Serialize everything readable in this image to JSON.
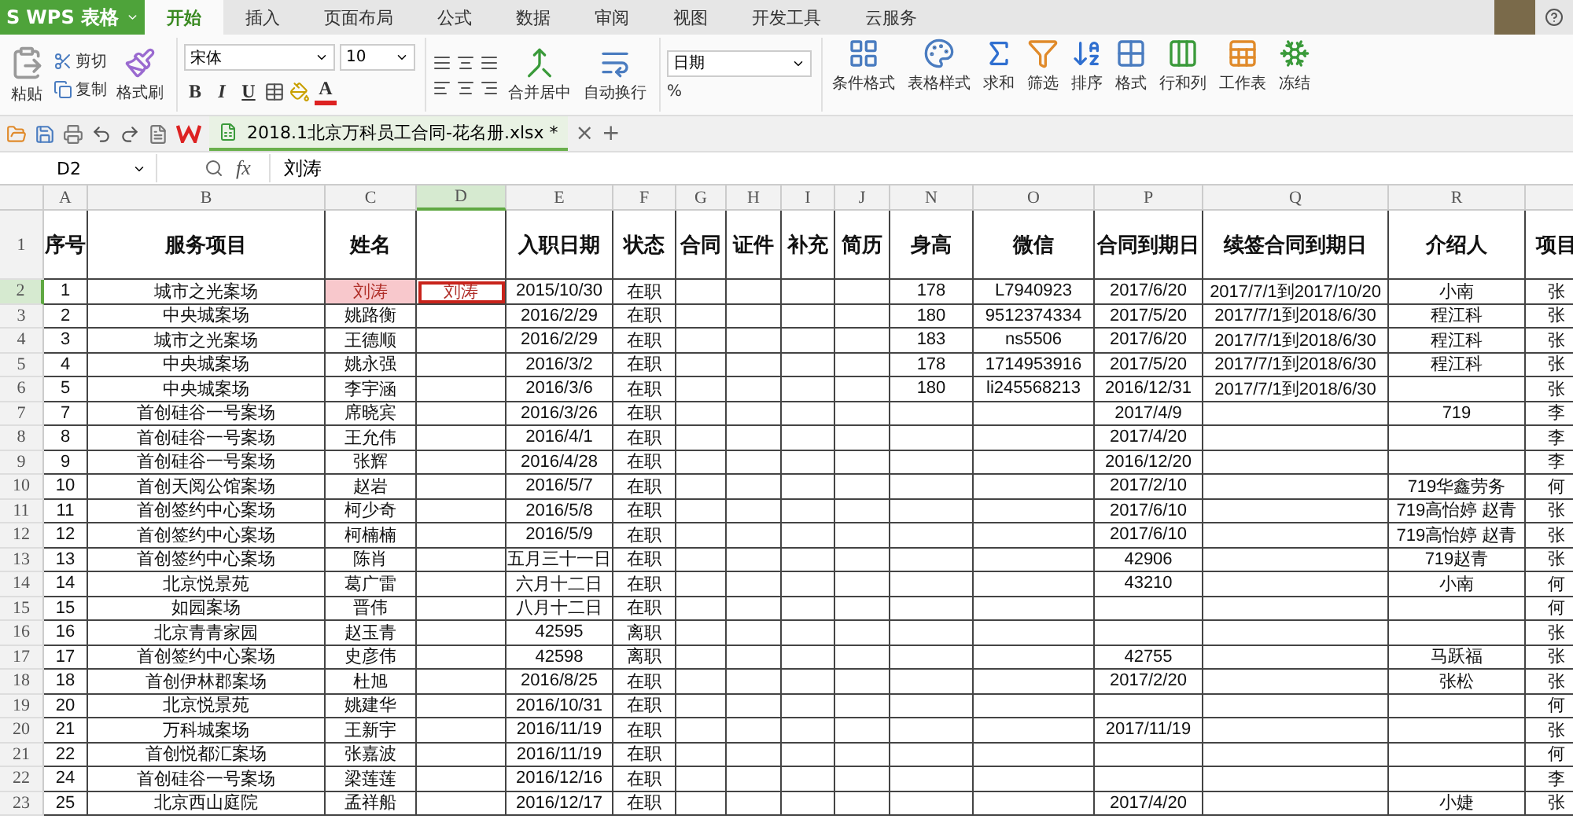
{
  "app_button": {
    "logo": "S",
    "label": "WPS 表格"
  },
  "menu_tabs": [
    {
      "label": "开始",
      "selected": true
    },
    {
      "label": "插入",
      "selected": false
    },
    {
      "label": "页面布局",
      "selected": false
    },
    {
      "label": "公式",
      "selected": false
    },
    {
      "label": "数据",
      "selected": false
    },
    {
      "label": "审阅",
      "selected": false
    },
    {
      "label": "视图",
      "selected": false
    },
    {
      "label": "开发工具",
      "selected": false
    },
    {
      "label": "云服务",
      "selected": false
    }
  ],
  "ribbon": {
    "paste": "粘贴",
    "cut": "剪切",
    "copy": "复制",
    "format_painter": "格式刷",
    "font_name": "宋体",
    "font_size": "10",
    "bold": "B",
    "italic": "I",
    "underline": "U",
    "font_color": "A",
    "merge": "合并居中",
    "wrap": "自动换行",
    "number_format": "日期",
    "percent": "%",
    "big_buttons": [
      {
        "label": "条件格式",
        "kind": "conditional"
      },
      {
        "label": "表格样式",
        "kind": "style"
      },
      {
        "label": "求和",
        "kind": "sum"
      },
      {
        "label": "筛选",
        "kind": "filter"
      },
      {
        "label": "排序",
        "kind": "sort"
      },
      {
        "label": "格式",
        "kind": "format"
      },
      {
        "label": "行和列",
        "kind": "rowscols"
      },
      {
        "label": "工作表",
        "kind": "sheet"
      },
      {
        "label": "冻结",
        "kind": "freeze"
      }
    ]
  },
  "document_tab": {
    "title": "2018.1北京万科员工合同-花名册.xlsx *",
    "close": "×",
    "new": "+"
  },
  "formula_bar": {
    "name_box": "D2",
    "fx": "fx",
    "value": "刘涛"
  },
  "sheet": {
    "columns": [
      {
        "letter": "A",
        "header": "序号",
        "selected": false
      },
      {
        "letter": "B",
        "header": "服务项目",
        "selected": false
      },
      {
        "letter": "C",
        "header": "姓名",
        "selected": false
      },
      {
        "letter": "D",
        "selected": true
      },
      {
        "letter": "E",
        "header": "入职日期",
        "selected": false
      },
      {
        "letter": "F",
        "header": "状态",
        "selected": false
      },
      {
        "letter": "G",
        "header": "合同",
        "selected": false
      },
      {
        "letter": "H",
        "header": "证件",
        "selected": false
      },
      {
        "letter": "I",
        "header": "补充",
        "selected": false
      },
      {
        "letter": "J",
        "header": "简历",
        "selected": false
      },
      {
        "letter": "N",
        "header": "身高",
        "selected": false
      },
      {
        "letter": "O",
        "header": "微信",
        "selected": false
      },
      {
        "letter": "P",
        "header": "合同到期日",
        "selected": false
      },
      {
        "letter": "Q",
        "header": "续签合同到期日",
        "selected": false
      },
      {
        "letter": "R",
        "header": "介绍人",
        "selected": false
      },
      {
        "header": "项目",
        "selected": false
      }
    ],
    "header_row_number": "1",
    "rows": [
      {
        "number": "2",
        "selected": true,
        "cells": [
          "1",
          "城市之光案场",
          {
            "text": "刘涛",
            "highlighted": true,
            "selected": false
          },
          {
            "text": "刘涛",
            "highlighted": false,
            "selected": true
          },
          "2015/10/30",
          "在职",
          null,
          null,
          null,
          null,
          "178",
          "L7940923",
          "2017/6/20",
          "2017/7/1到2017/10/20",
          "小南",
          "张"
        ]
      },
      {
        "number": "3",
        "selected": false,
        "cells": [
          "2",
          "中央城案场",
          "姚路衡",
          null,
          "2016/2/29",
          "在职",
          null,
          null,
          null,
          null,
          "180",
          "9512374334",
          "2017/5/20",
          "2017/7/1到2018/6/30",
          "程江科",
          "张"
        ]
      },
      {
        "number": "4",
        "selected": false,
        "cells": [
          "3",
          "城市之光案场",
          "王德顺",
          null,
          "2016/2/29",
          "在职",
          null,
          null,
          null,
          null,
          "183",
          "ns5506",
          "2017/6/20",
          "2017/7/1到2018/6/30",
          "程江科",
          "张"
        ]
      },
      {
        "number": "5",
        "selected": false,
        "cells": [
          "4",
          "中央城案场",
          "姚永强",
          null,
          "2016/3/2",
          "在职",
          null,
          null,
          null,
          null,
          "178",
          "1714953916",
          "2017/5/20",
          "2017/7/1到2018/6/30",
          "程江科",
          "张"
        ]
      },
      {
        "number": "6",
        "selected": false,
        "cells": [
          "5",
          "中央城案场",
          "李宇涵",
          null,
          "2016/3/6",
          "在职",
          null,
          null,
          null,
          null,
          "180",
          "li245568213",
          "2016/12/31",
          "2017/7/1到2018/6/30",
          null,
          "张"
        ]
      },
      {
        "number": "7",
        "selected": false,
        "cells": [
          "7",
          "首创硅谷一号案场",
          "席晓宾",
          null,
          "2016/3/26",
          "在职",
          null,
          null,
          null,
          null,
          null,
          null,
          "2017/4/9",
          null,
          "719",
          "李"
        ]
      },
      {
        "number": "8",
        "selected": false,
        "cells": [
          "8",
          "首创硅谷一号案场",
          "王允伟",
          null,
          "2016/4/1",
          "在职",
          null,
          null,
          null,
          null,
          null,
          null,
          "2017/4/20",
          null,
          null,
          "李"
        ]
      },
      {
        "number": "9",
        "selected": false,
        "cells": [
          "9",
          "首创硅谷一号案场",
          "张辉",
          null,
          "2016/4/28",
          "在职",
          null,
          null,
          null,
          null,
          null,
          null,
          "2016/12/20",
          null,
          null,
          "李"
        ]
      },
      {
        "number": "10",
        "selected": false,
        "cells": [
          "10",
          "首创天阅公馆案场",
          "赵岩",
          null,
          "2016/5/7",
          "在职",
          null,
          null,
          null,
          null,
          null,
          null,
          "2017/2/10",
          null,
          "719华鑫劳务",
          "何"
        ]
      },
      {
        "number": "11",
        "selected": false,
        "cells": [
          "11",
          "首创签约中心案场",
          "柯少奇",
          null,
          "2016/5/8",
          "在职",
          null,
          null,
          null,
          null,
          null,
          null,
          "2017/6/10",
          null,
          "719高怡婷 赵青",
          "张"
        ]
      },
      {
        "number": "12",
        "selected": false,
        "cells": [
          "12",
          "首创签约中心案场",
          "柯楠楠",
          null,
          "2016/5/9",
          "在职",
          null,
          null,
          null,
          null,
          null,
          null,
          "2017/6/10",
          null,
          "719高怡婷 赵青",
          "张"
        ]
      },
      {
        "number": "13",
        "selected": false,
        "cells": [
          "13",
          "首创签约中心案场",
          "陈肖",
          null,
          "五月三十一日",
          "在职",
          null,
          null,
          null,
          null,
          null,
          null,
          "42906",
          null,
          "719赵青",
          "张"
        ]
      },
      {
        "number": "14",
        "selected": false,
        "cells": [
          "14",
          "北京悦景苑",
          "葛广雷",
          null,
          "六月十二日",
          "在职",
          null,
          null,
          null,
          null,
          null,
          null,
          "43210",
          null,
          "小南",
          "何"
        ]
      },
      {
        "number": "15",
        "selected": false,
        "cells": [
          "15",
          "如园案场",
          "晋伟",
          null,
          "八月十二日",
          "在职",
          null,
          null,
          null,
          null,
          null,
          null,
          null,
          null,
          null,
          "何"
        ]
      },
      {
        "number": "16",
        "selected": false,
        "cells": [
          "16",
          "北京青青家园",
          "赵玉青",
          null,
          "42595",
          "离职",
          null,
          null,
          null,
          null,
          null,
          null,
          null,
          null,
          null,
          "张"
        ]
      },
      {
        "number": "17",
        "selected": false,
        "cells": [
          "17",
          "首创签约中心案场",
          "史彦伟",
          null,
          "42598",
          "离职",
          null,
          null,
          null,
          null,
          null,
          null,
          "42755",
          null,
          "马跃福",
          "张"
        ]
      },
      {
        "number": "18",
        "selected": false,
        "cells": [
          "18",
          "首创伊林郡案场",
          "杜旭",
          null,
          "2016/8/25",
          "在职",
          null,
          null,
          null,
          null,
          null,
          null,
          "2017/2/20",
          null,
          "张松",
          "张"
        ]
      },
      {
        "number": "19",
        "selected": false,
        "cells": [
          "20",
          "北京悦景苑",
          "姚建华",
          null,
          "2016/10/31",
          "在职",
          null,
          null,
          null,
          null,
          null,
          null,
          null,
          null,
          null,
          "何"
        ]
      },
      {
        "number": "20",
        "selected": false,
        "cells": [
          "21",
          "万科城案场",
          "王新宇",
          null,
          "2016/11/19",
          "在职",
          null,
          null,
          null,
          null,
          null,
          null,
          "2017/11/19",
          null,
          null,
          "张"
        ]
      },
      {
        "number": "21",
        "selected": false,
        "cells": [
          "22",
          "首创悦都汇案场",
          "张嘉波",
          null,
          "2016/11/19",
          "在职",
          null,
          null,
          null,
          null,
          null,
          null,
          null,
          null,
          null,
          "何"
        ]
      },
      {
        "number": "22",
        "selected": false,
        "cells": [
          "24",
          "首创硅谷一号案场",
          "梁莲莲",
          null,
          "2016/12/16",
          "在职",
          null,
          null,
          null,
          null,
          null,
          null,
          null,
          null,
          null,
          "李"
        ]
      },
      {
        "number": "23",
        "selected": false,
        "cells": [
          "25",
          "北京西山庭院",
          "孟祥船",
          null,
          "2016/12/17",
          "在职",
          null,
          null,
          null,
          null,
          null,
          null,
          "2017/4/20",
          null,
          "小婕",
          "张"
        ]
      }
    ]
  }
}
